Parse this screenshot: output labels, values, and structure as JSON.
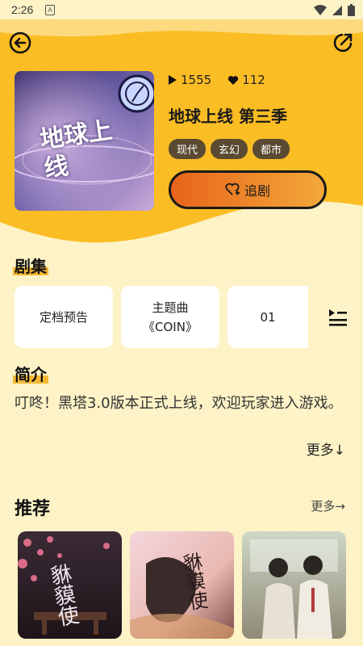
{
  "status": {
    "time": "2:26",
    "badge": "A"
  },
  "show": {
    "plays": "1555",
    "likes": "112",
    "title": "地球上线 第三季",
    "cover_text": "地球上线",
    "tags": [
      "现代",
      "玄幻",
      "都市"
    ],
    "follow_label": "追剧"
  },
  "episodes": {
    "title": "剧集",
    "items": [
      "定档预告",
      "主题曲\n《COIN》",
      "01"
    ]
  },
  "intro": {
    "title": "简介",
    "text": "叮咚！黑塔3.0版本正式上线，欢迎玩家进入游戏。",
    "more": "更多↓"
  },
  "recommend": {
    "title": "推荐",
    "more": "更多→",
    "items": [
      {
        "cover_text": "貅貘使"
      },
      {
        "cover_text": "貅貘使"
      },
      {
        "cover_text": ""
      }
    ]
  },
  "colors": {
    "accent": "#f5b731",
    "background": "#fdf3c6",
    "tag": "#5a4a32"
  }
}
